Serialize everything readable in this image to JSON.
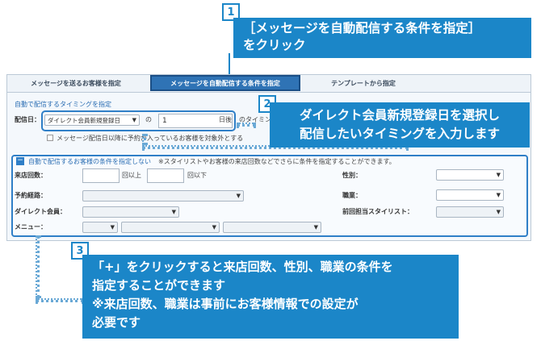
{
  "tabs": [
    {
      "label": "メッセージを送るお客様を指定"
    },
    {
      "label": "メッセージを自動配信する条件を指定"
    },
    {
      "label": "テンプレートから指定"
    }
  ],
  "timing": {
    "section_title": "自動で配信するタイミングを指定",
    "date_label": "配信日：",
    "date_select": "ダイレクト会員新規登録日",
    "of_text": "の",
    "days_value": "1",
    "days_after": "日後",
    "timing_text": "のタイミン",
    "checkbox_label": "メッセージ配信日以降に予約が入っているお客様を対象外とする"
  },
  "conditions": {
    "toggle_label": "自動で配信するお客様の条件を指定しない",
    "note": "※スタイリストやお客様の来店回数などでさらに条件を指定することができます。",
    "visits_label": "来店回数：",
    "visits_min_suffix": "回以上",
    "visits_max_suffix": "回以下",
    "gender_label": "性別：",
    "route_label": "予約経路：",
    "job_label": "職業：",
    "direct_label": "ダイレクト会員：",
    "stylist_label": "前回担当スタイリスト：",
    "menu_label": "メニュー："
  },
  "callouts": [
    {
      "num": "1",
      "line1": "［メッセージを自動配信する条件を指定］",
      "line2": "をクリック"
    },
    {
      "num": "2",
      "line1": "ダイレクト会員新規登録日を選択し",
      "line2": "配信したいタイミングを入力します"
    },
    {
      "num": "3",
      "line1": "「+」をクリックすると来店回数、性別、職業の条件を",
      "line2": "指定することができます",
      "line3": "※来店回数、職業は事前にお客様情報での設定が",
      "line4": "必要です"
    }
  ],
  "colors": {
    "accent": "#1b86c8",
    "tab_active": "#2f73b5",
    "panel_bg": "#f4f8fc"
  }
}
